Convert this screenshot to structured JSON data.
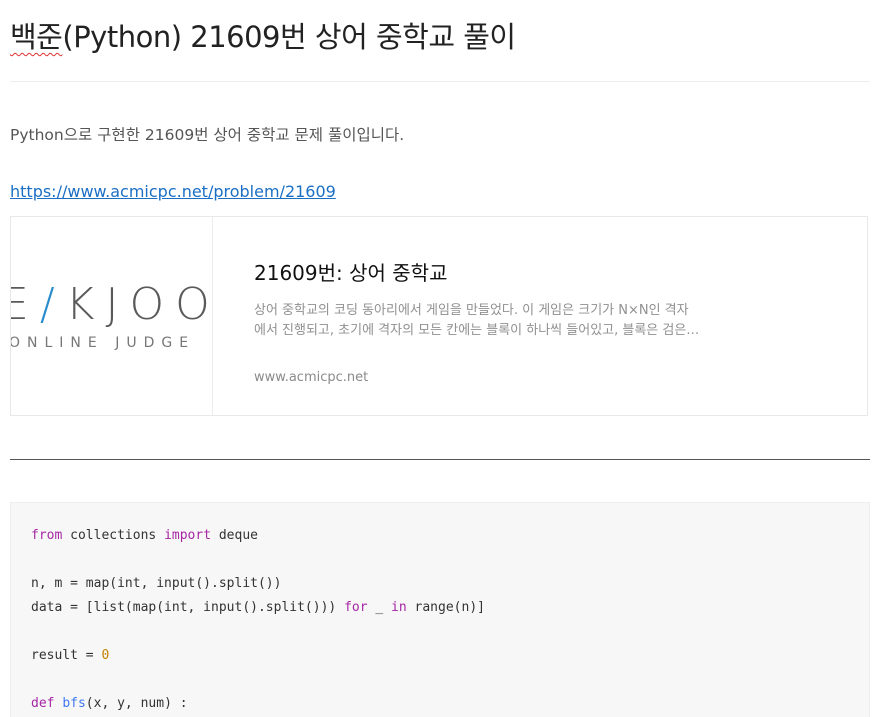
{
  "post": {
    "title_underlined": "백준",
    "title_rest": "(Python) 21609번 상어 중학교 풀이",
    "intro": "Python으로 구현한 21609번 상어 중학교 문제 풀이입니다.",
    "link": "https://www.acmicpc.net/problem/21609"
  },
  "card": {
    "logo_main_left": "E",
    "logo_main_slash": "/",
    "logo_main_right": "KJOO",
    "logo_sub": "ONLINE JUDGE",
    "title": "21609번: 상어 중학교",
    "desc_line1": "상어 중학교의 코딩 동아리에서 게임을 만들었다. 이 게임은 크기가 N×N인 격자",
    "desc_line2": "에서 진행되고, 초기에 격자의 모든 칸에는 블록이 하나씩 들어있고, 블록은 검은…",
    "host": "www.acmicpc.net"
  },
  "code": {
    "l1_kw1": "from",
    "l1_mid": " collections ",
    "l1_kw2": "import",
    "l1_end": " deque",
    "l3": "n, m = map(int, input().split())",
    "l4_a": "data = [list(map(int, input().split())) ",
    "l4_kw1": "for",
    "l4_b": " _ ",
    "l4_kw2": "in",
    "l4_c": " range(n)]",
    "l6_a": "result = ",
    "l6_num": "0",
    "l8_kw": "def",
    "l8_sp": " ",
    "l8_fn": "bfs",
    "l8_rest": "(x, y, num) :"
  },
  "colors": {
    "link": "#1a6fc4",
    "keyword": "#a626a4",
    "function": "#4078f2",
    "number": "#c18401",
    "logo_accent": "#2b8ccc"
  }
}
